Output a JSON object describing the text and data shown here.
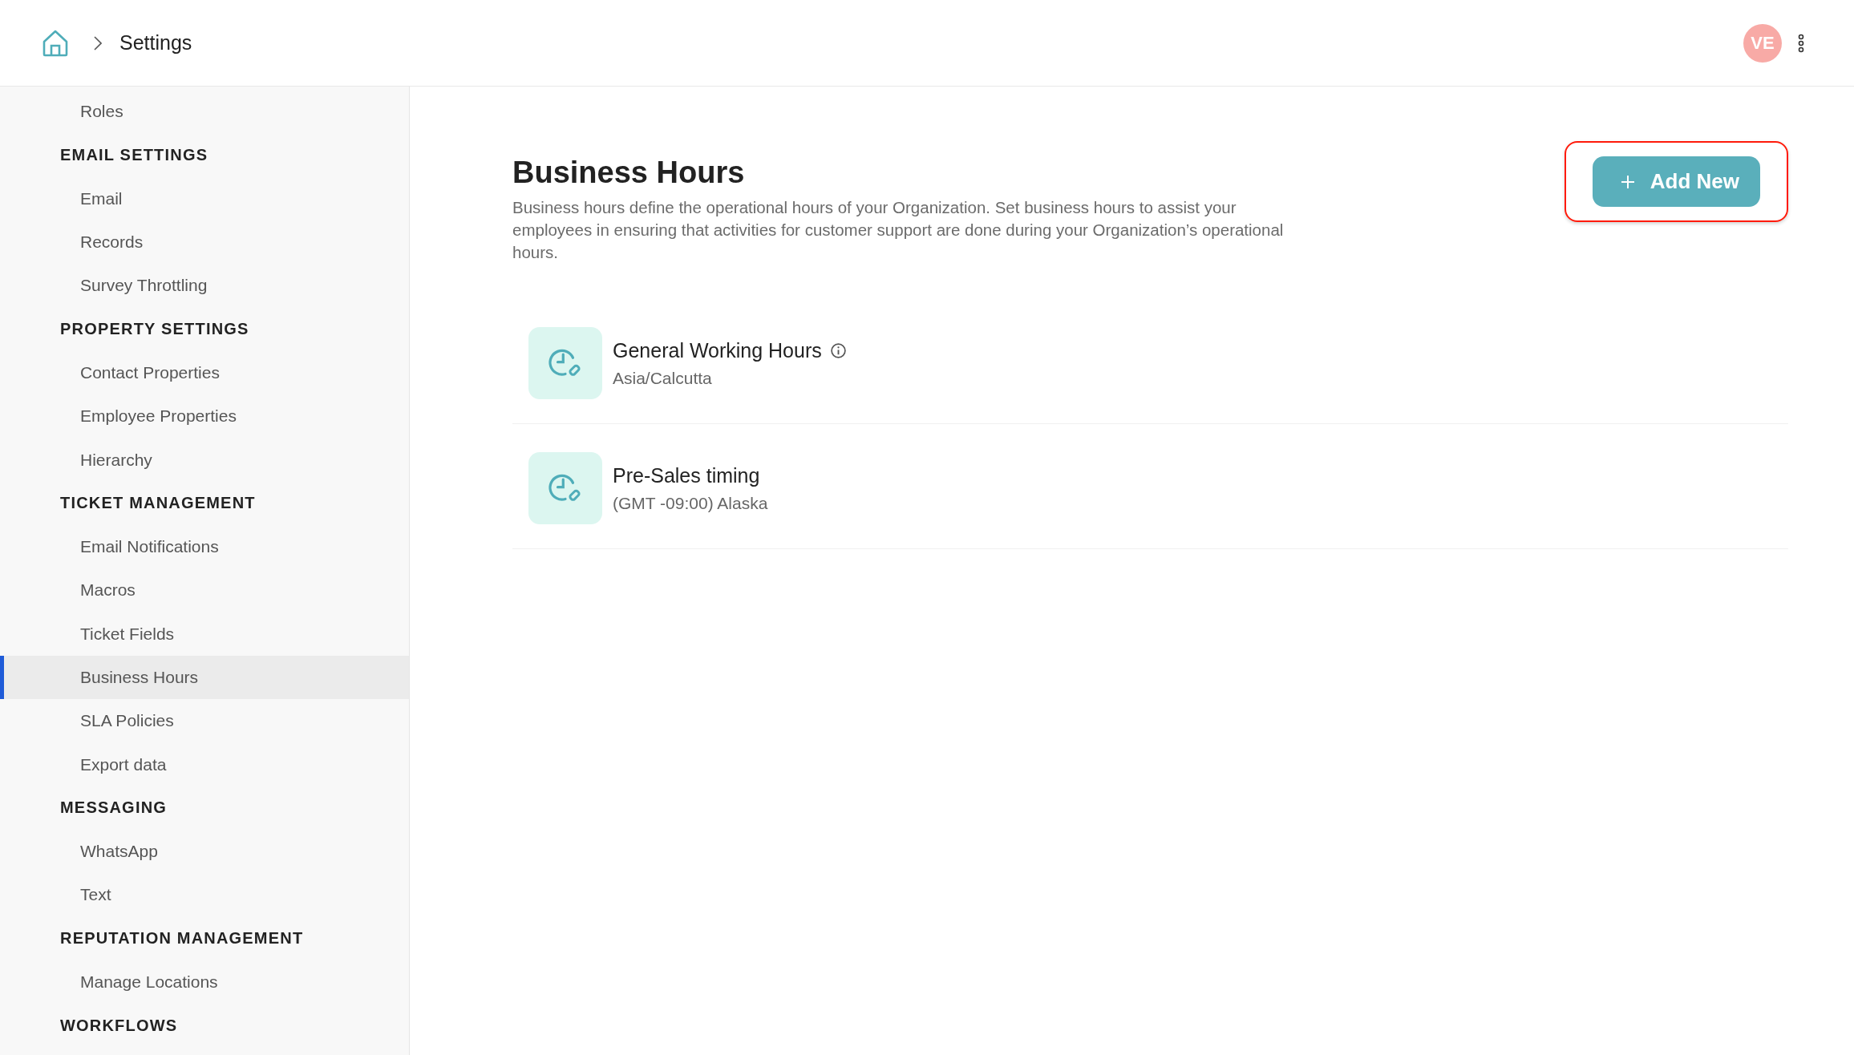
{
  "breadcrumb": {
    "current": "Settings"
  },
  "user": {
    "initials": "VE"
  },
  "sidebar": [
    {
      "kind": "item",
      "label": "Roles",
      "selected": false
    },
    {
      "kind": "heading",
      "label": "EMAIL SETTINGS"
    },
    {
      "kind": "item",
      "label": "Email",
      "selected": false
    },
    {
      "kind": "item",
      "label": "Records",
      "selected": false
    },
    {
      "kind": "item",
      "label": "Survey Throttling",
      "selected": false
    },
    {
      "kind": "heading",
      "label": "PROPERTY SETTINGS"
    },
    {
      "kind": "item",
      "label": "Contact Properties",
      "selected": false
    },
    {
      "kind": "item",
      "label": "Employee Properties",
      "selected": false
    },
    {
      "kind": "item",
      "label": "Hierarchy",
      "selected": false
    },
    {
      "kind": "heading",
      "label": "TICKET MANAGEMENT"
    },
    {
      "kind": "item",
      "label": "Email Notifications",
      "selected": false
    },
    {
      "kind": "item",
      "label": "Macros",
      "selected": false
    },
    {
      "kind": "item",
      "label": "Ticket Fields",
      "selected": false
    },
    {
      "kind": "item",
      "label": "Business Hours",
      "selected": true
    },
    {
      "kind": "item",
      "label": "SLA Policies",
      "selected": false
    },
    {
      "kind": "item",
      "label": "Export data",
      "selected": false
    },
    {
      "kind": "heading",
      "label": "MESSAGING"
    },
    {
      "kind": "item",
      "label": "WhatsApp",
      "selected": false
    },
    {
      "kind": "item",
      "label": "Text",
      "selected": false
    },
    {
      "kind": "heading",
      "label": "REPUTATION MANAGEMENT"
    },
    {
      "kind": "item",
      "label": "Manage Locations",
      "selected": false
    },
    {
      "kind": "heading",
      "label": "WORKFLOWS"
    }
  ],
  "page": {
    "title": "Business Hours",
    "description": "Business hours define the operational hours of your Organization. Set business hours to assist your employees in ensuring that activities for customer support are done during your Organization’s operational hours.",
    "add_button": {
      "label": "Add New",
      "highlighted": true
    }
  },
  "schedules": [
    {
      "name": "General Working Hours",
      "timezone": "Asia/Calcutta",
      "info": true
    },
    {
      "name": "Pre-Sales timing",
      "timezone": "(GMT -09:00) Alaska",
      "info": false
    }
  ]
}
